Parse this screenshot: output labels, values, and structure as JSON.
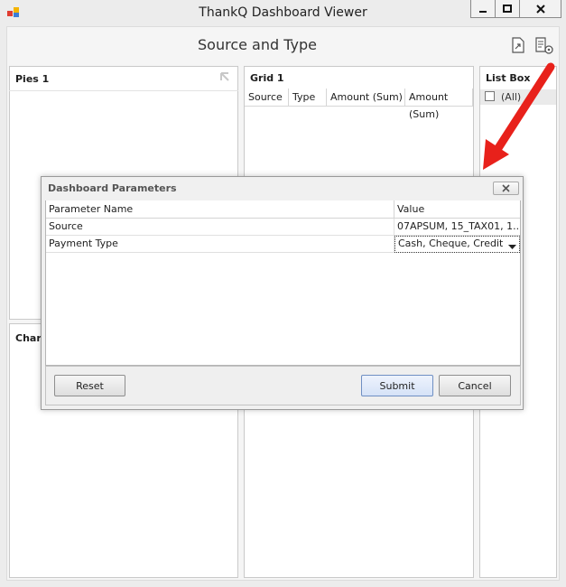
{
  "window": {
    "title": "ThankQ Dashboard Viewer",
    "controls": {
      "minimize": "minimize-icon",
      "maximize": "maximize-icon",
      "close": "close-icon"
    }
  },
  "dashboard": {
    "title": "Source and Type",
    "toolbar_icons": [
      "export-icon",
      "parameters-icon"
    ]
  },
  "panels": {
    "pies": {
      "caption": "Pies 1"
    },
    "grid": {
      "caption": "Grid 1",
      "columns": [
        "Source",
        "Type",
        "Amount (Sum)",
        "Amount (Sum)"
      ]
    },
    "listbox": {
      "caption": "List Box",
      "all_label": "(All)"
    },
    "chart": {
      "caption": "Chart"
    }
  },
  "dialog": {
    "title": "Dashboard Parameters",
    "columns": {
      "name": "Parameter Name",
      "value": "Value"
    },
    "rows": [
      {
        "name": "Source",
        "value": "07APSUM, 15_TAX01, 1..."
      },
      {
        "name": "Payment Type",
        "value": "Cash, Cheque, Credit..."
      }
    ],
    "buttons": {
      "reset": "Reset",
      "submit": "Submit",
      "cancel": "Cancel"
    }
  },
  "annotation": {
    "color": "#e8211b"
  }
}
